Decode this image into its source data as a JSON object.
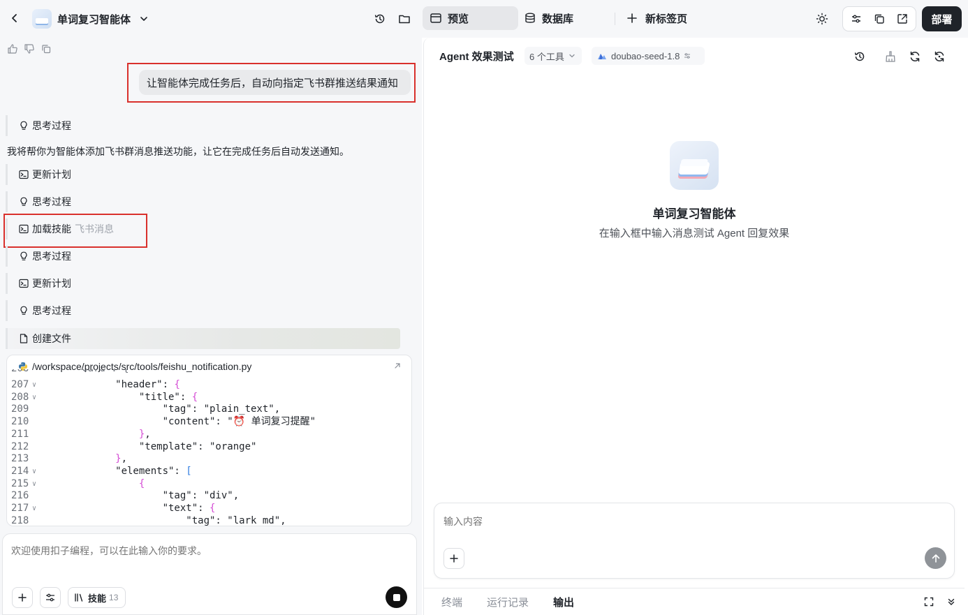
{
  "header": {
    "project_name": "单词复习智能体",
    "tabs": [
      {
        "label": "预览",
        "active": true
      },
      {
        "label": "数据库",
        "active": false
      },
      {
        "label": "新标签页",
        "active": false
      }
    ],
    "deploy_label": "部署"
  },
  "chat": {
    "user_message": "让智能体完成任务后，自动向指定飞书群推送结果通知",
    "assistant_intro": "我将帮你为智能体添加飞书群消息推送功能，让它在完成任务后自动发送通知。",
    "steps": [
      {
        "label": "思考过程",
        "icon": "bulb-icon",
        "detail": ""
      },
      {
        "label": "更新计划",
        "icon": "terminal-icon",
        "detail": ""
      },
      {
        "label": "思考过程",
        "icon": "bulb-icon",
        "detail": ""
      },
      {
        "label": "加载技能",
        "icon": "terminal-icon",
        "detail": "飞书消息"
      },
      {
        "label": "思考过程",
        "icon": "bulb-icon",
        "detail": ""
      },
      {
        "label": "更新计划",
        "icon": "terminal-icon",
        "detail": ""
      },
      {
        "label": "思考过程",
        "icon": "bulb-icon",
        "detail": ""
      },
      {
        "label": "创建文件",
        "icon": "file-icon",
        "detail": ""
      }
    ],
    "file_path": "/workspace/projects/src/tools/feishu_notification.py",
    "code_lines": [
      {
        "n": "207",
        "fold": true,
        "text": "            \"header\": {"
      },
      {
        "n": "208",
        "fold": true,
        "text": "                \"title\": {"
      },
      {
        "n": "209",
        "fold": false,
        "text": "                    \"tag\": \"plain_text\","
      },
      {
        "n": "210",
        "fold": false,
        "text": "                    \"content\": \"⏰ 单词复习提醒\""
      },
      {
        "n": "211",
        "fold": false,
        "text": "                },"
      },
      {
        "n": "212",
        "fold": false,
        "text": "                \"template\": \"orange\""
      },
      {
        "n": "213",
        "fold": false,
        "text": "            },"
      },
      {
        "n": "214",
        "fold": true,
        "text": "            \"elements\": ["
      },
      {
        "n": "215",
        "fold": true,
        "text": "                {"
      },
      {
        "n": "216",
        "fold": false,
        "text": "                    \"tag\": \"div\","
      },
      {
        "n": "217",
        "fold": true,
        "text": "                    \"text\": {"
      },
      {
        "n": "218",
        "fold": false,
        "text": "                        \"tag\": \"lark_md\","
      }
    ],
    "input_placeholder": "欢迎使用扣子编程，可以在此输入你的要求。",
    "skills_label": "技能",
    "skills_count": "13"
  },
  "preview": {
    "title": "Agent 效果测试",
    "tools_label": "6 个工具",
    "model_label": "doubao-seed-1.8",
    "agent_name": "单词复习智能体",
    "agent_hint": "在输入框中输入消息测试 Agent 回复效果",
    "input_placeholder": "输入内容",
    "bottom_tabs": [
      {
        "label": "终端",
        "active": false
      },
      {
        "label": "运行记录",
        "active": false
      },
      {
        "label": "输出",
        "active": true
      }
    ]
  }
}
